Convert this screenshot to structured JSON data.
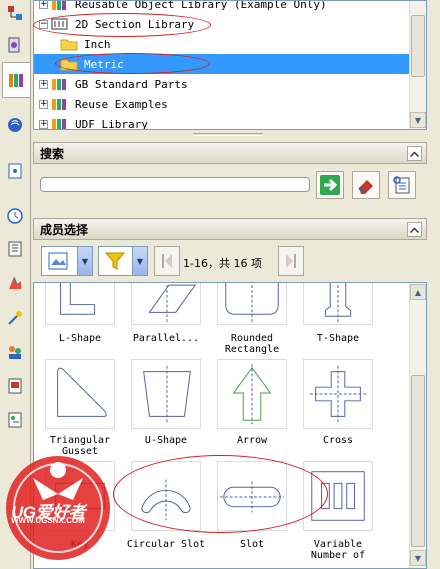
{
  "tree": {
    "rows": [
      {
        "label": "Reusable Object Library (Example Only)",
        "expander": "+",
        "icon": "books-icon",
        "selected": false
      },
      {
        "label": "2D Section Library",
        "expander": "−",
        "icon": "section-library-icon",
        "selected": false
      },
      {
        "label": "Inch",
        "expander": "",
        "icon": "folder-icon",
        "selected": false
      },
      {
        "label": "Metric",
        "expander": "",
        "icon": "folder-icon",
        "selected": true
      },
      {
        "label": "GB Standard Parts",
        "expander": "+",
        "icon": "books-icon",
        "selected": false
      },
      {
        "label": "Reuse Examples",
        "expander": "+",
        "icon": "books-icon",
        "selected": false
      },
      {
        "label": "UDF Library",
        "expander": "+",
        "icon": "books-icon",
        "selected": false
      }
    ]
  },
  "search": {
    "title": "搜索",
    "input_value": "",
    "buttons": [
      "go-search-icon",
      "eraser-icon",
      "advanced-search-icon"
    ]
  },
  "members": {
    "title": "成员选择",
    "page_info": "1-16，共 16 项",
    "items": [
      {
        "label": "L-Shape"
      },
      {
        "label": "Parallel..."
      },
      {
        "label": "Rounded Rectangle"
      },
      {
        "label": "T-Shape"
      },
      {
        "label": "Triangular Gusset"
      },
      {
        "label": "U-Shape"
      },
      {
        "label": "Arrow"
      },
      {
        "label": "Cross"
      },
      {
        "label": "Key"
      },
      {
        "label": "Circular Slot"
      },
      {
        "label": "Slot"
      },
      {
        "label": "Variable Number of"
      }
    ]
  },
  "watermark": {
    "brand": "UG爱好者",
    "url": "WWW.UGSNX.COM"
  },
  "colors": {
    "selection": "#3399ff",
    "annotation_red": "#d42020",
    "panel_bg": "#ece9d8"
  }
}
